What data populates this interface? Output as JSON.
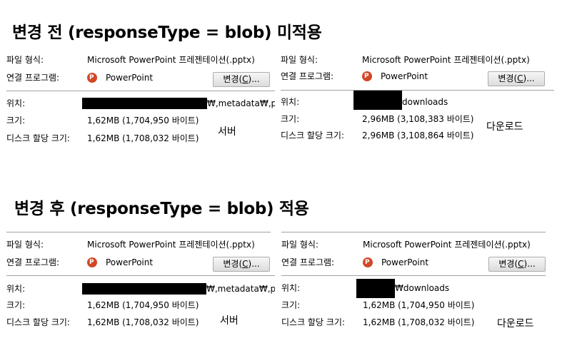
{
  "headings": {
    "before": "변경 전 (responseType = blob) 미적용",
    "after": "변경 후 (responseType = blob) 적용"
  },
  "labels": {
    "file_type": "파일 형식:",
    "open_with": "연결 프로그램:",
    "location": "위치:",
    "size": "크기:",
    "size_on_disk": "디스크 할당 크기:",
    "change_button_text": "변경(",
    "change_button_key": "C",
    "change_button_suffix": ")..."
  },
  "panels": {
    "before_server": {
      "file_type_value": "Microsoft PowerPoint 프레젠테이션(.pptx)",
      "program": "PowerPoint",
      "location_value": "₩,metadata₩,plu",
      "size_value": "1,62MB (1,704,950 바이트)",
      "disk_value": "1,62MB (1,708,032 바이트)",
      "note": "서버"
    },
    "before_download": {
      "file_type_value": "Microsoft PowerPoint 프레젠테이션(.pptx)",
      "program": "PowerPoint",
      "location_value": "downloads",
      "size_value": "2,96MB (3,108,383 바이트)",
      "disk_value": "2,96MB (3,108,864 바이트)",
      "note": "다운로드"
    },
    "after_server": {
      "file_type_value": "Microsoft PowerPoint 프레젠테이션(.pptx)",
      "program": "PowerPoint",
      "location_value": "₩,metadata₩,plu",
      "size_value": "1,62MB (1,704,950 바이트)",
      "disk_value": "1,62MB (1,708,032 바이트)",
      "note": "서버"
    },
    "after_download": {
      "file_type_value": "Microsoft PowerPoint 프레젠테이션(.pptx)",
      "program": "PowerPoint",
      "location_value": "₩downloads",
      "size_value": "1,62MB (1,704,950 바이트)",
      "disk_value": "1,62MB (1,708,032 바이트)",
      "note": "다운로드"
    }
  },
  "colors": {
    "ppt_icon": "#d24726",
    "redaction": "#000000"
  },
  "icons": {
    "program": "powerpoint-icon"
  }
}
